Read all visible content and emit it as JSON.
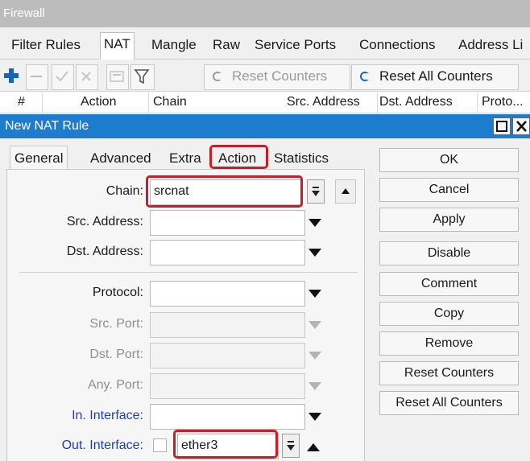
{
  "window": {
    "title": "Firewall"
  },
  "tabs": [
    "Filter Rules",
    "NAT",
    "Mangle",
    "Raw",
    "Service Ports",
    "Connections",
    "Address Li"
  ],
  "active_tab": "NAT",
  "toolbar": {
    "reset_counters": "Reset Counters",
    "reset_all_counters": "Reset All Counters"
  },
  "columns": [
    "#",
    "Action",
    "Chain",
    "Src. Address",
    "Dst. Address",
    "Proto..."
  ],
  "dialog": {
    "title": "New NAT Rule",
    "tabs": [
      "General",
      "Advanced",
      "Extra",
      "Action",
      "Statistics"
    ],
    "active_tab": "General",
    "highlighted_tab": "Action",
    "fields": {
      "chain": {
        "label": "Chain:",
        "value": "srcnat"
      },
      "src_address": {
        "label": "Src. Address:"
      },
      "dst_address": {
        "label": "Dst. Address:"
      },
      "protocol": {
        "label": "Protocol:"
      },
      "src_port": {
        "label": "Src. Port:"
      },
      "dst_port": {
        "label": "Dst. Port:"
      },
      "any_port": {
        "label": "Any. Port:"
      },
      "in_interface": {
        "label": "In. Interface:"
      },
      "out_interface": {
        "label": "Out. Interface:",
        "value": "ether3"
      }
    },
    "buttons": {
      "ok": "OK",
      "cancel": "Cancel",
      "apply": "Apply",
      "disable": "Disable",
      "comment": "Comment",
      "copy": "Copy",
      "remove": "Remove",
      "reset_counters": "Reset Counters",
      "reset_all_counters": "Reset All Counters"
    }
  },
  "colors": {
    "title_bar": "#1e7ccf",
    "highlight": "#c3202b",
    "interface_label": "#1f3fb0",
    "add_icon": "#1565c0"
  }
}
